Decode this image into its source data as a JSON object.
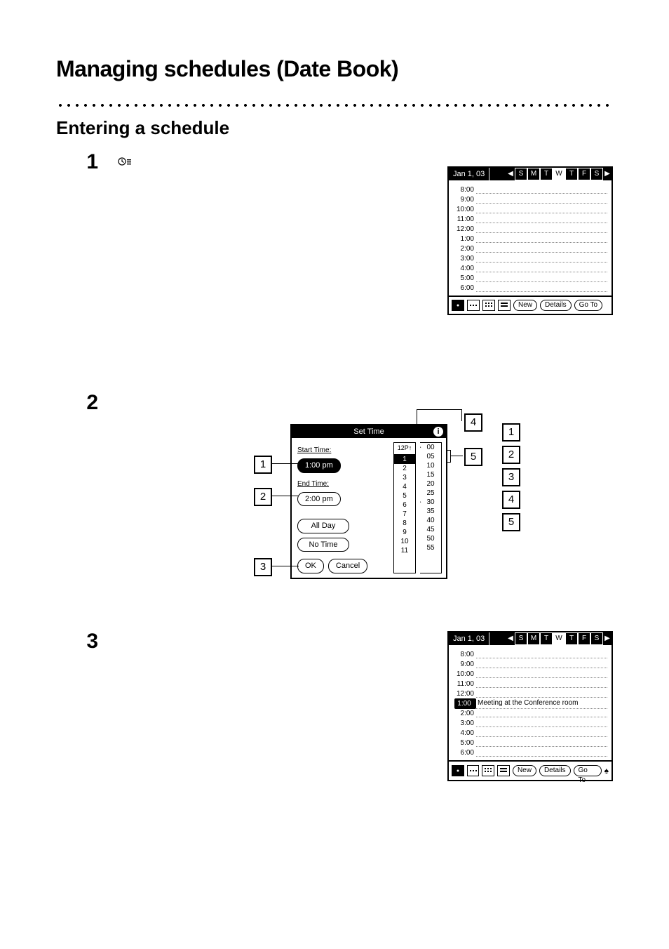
{
  "page": {
    "title": "Managing schedules (Date Book)",
    "section": "Entering a schedule"
  },
  "steps": {
    "s1": {
      "num": "1"
    },
    "s2": {
      "num": "2"
    },
    "s3": {
      "num": "3"
    }
  },
  "pda_day": {
    "date": "Jan 1, 03",
    "days": [
      "S",
      "M",
      "T",
      "W",
      "T",
      "F",
      "S"
    ],
    "slots": [
      "8:00",
      "9:00",
      "10:00",
      "11:00",
      "12:00",
      "1:00",
      "2:00",
      "3:00",
      "4:00",
      "5:00",
      "6:00"
    ],
    "buttons": {
      "new": "New",
      "details": "Details",
      "goto": "Go To"
    }
  },
  "pda_day2": {
    "date": "Jan 1, 03",
    "days": [
      "S",
      "M",
      "T",
      "W",
      "T",
      "F",
      "S"
    ],
    "slots": [
      "8:00",
      "9:00",
      "10:00",
      "11:00",
      "12:00"
    ],
    "entry_time": "1:00",
    "entry_text": "Meeting at the Conference room",
    "slots_after": [
      "2:00",
      "3:00",
      "4:00",
      "5:00",
      "6:00"
    ],
    "buttons": {
      "new": "New",
      "details": "Details",
      "goto": "Go To"
    }
  },
  "set_time": {
    "title": "Set Time",
    "start_label": "Start Time:",
    "start_value": "1:00 pm",
    "end_label": "End Time:",
    "end_value": "2:00 pm",
    "all_day": "All Day",
    "no_time": "No Time",
    "ok": "OK",
    "cancel": "Cancel",
    "hours_header": "12P↑",
    "hours": [
      "1",
      "2",
      "3",
      "4",
      "5",
      "6",
      "7",
      "8",
      "9",
      "10",
      "11"
    ],
    "hours_selected": "1",
    "minutes": [
      "00",
      "05",
      "10",
      "15",
      "20",
      "25",
      "30",
      "35",
      "40",
      "45",
      "50",
      "55"
    ],
    "minutes_current": [
      "00",
      "30"
    ]
  },
  "callouts": {
    "left": {
      "c1": "1",
      "c2": "2",
      "c3": "3"
    },
    "top": {
      "c4": "4",
      "c5": "5"
    },
    "right": {
      "r1": "1",
      "r2": "2",
      "r3": "3",
      "r4": "4",
      "r5": "5"
    }
  }
}
